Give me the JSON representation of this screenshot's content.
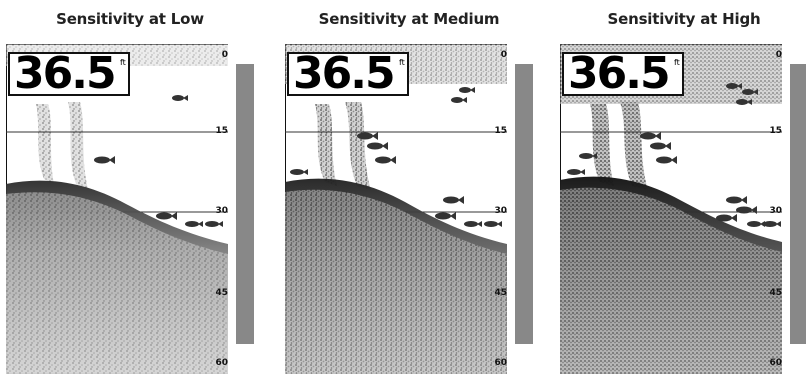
{
  "panels": [
    {
      "title": "Sensitivity at Low",
      "depth": "36.5",
      "unit": "ft",
      "scale": [
        "0",
        "15",
        "30",
        "45",
        "60"
      ],
      "sensitivity": "low"
    },
    {
      "title": "Sensitivity at Medium",
      "depth": "36.5",
      "unit": "ft",
      "scale": [
        "0",
        "15",
        "30",
        "45",
        "60"
      ],
      "sensitivity": "medium"
    },
    {
      "title": "Sensitivity at High",
      "depth": "36.5",
      "unit": "ft",
      "scale": [
        "0",
        "15",
        "30",
        "45",
        "60"
      ],
      "sensitivity": "high"
    }
  ],
  "colors": {
    "sonar_dark": "#2a2a2a",
    "sonar_light": "#bdbdbd",
    "fish": "#333333",
    "scale_bar": "#444444"
  },
  "icons": [
    "fish-icon"
  ]
}
